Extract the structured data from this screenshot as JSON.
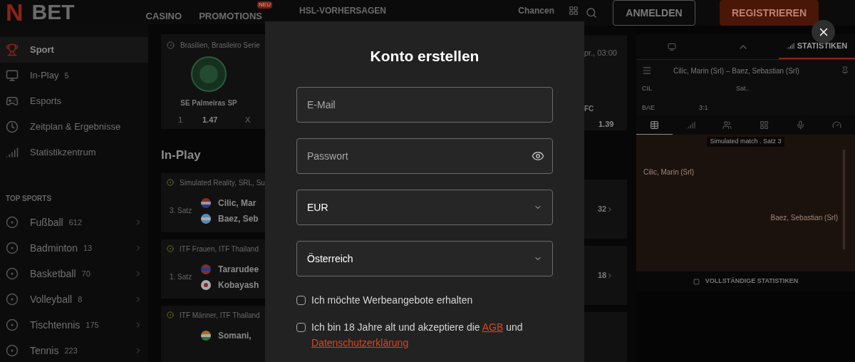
{
  "header": {
    "logo_mark": "N",
    "logo_text": "BET",
    "nav": [
      {
        "label": "CASINO"
      },
      {
        "label": "PROMOTIONS",
        "badge": "NEU"
      }
    ],
    "nav_hidden": [
      {
        "label": "HSL-VORHERSAGEN"
      },
      {
        "label": "Chancen"
      }
    ],
    "login": "ANMELDEN",
    "register": "REGISTRIEREN"
  },
  "sidebar": {
    "items": [
      {
        "kind": "trophy",
        "label": "Sport",
        "selected": true
      },
      {
        "kind": "monitor",
        "label": "In-Play",
        "count": "5",
        "selected": false
      },
      {
        "kind": "gamepad",
        "label": "Esports",
        "selected": false
      },
      {
        "kind": "clock",
        "label": "Zeitplan & Ergebnisse",
        "selected": false
      },
      {
        "kind": "stats",
        "label": "Statistikzentrum",
        "selected": false
      }
    ],
    "section_title": "TOP SPORTS",
    "sports": [
      {
        "label": "Fußball",
        "count": "612"
      },
      {
        "label": "Badminton",
        "count": "13"
      },
      {
        "label": "Basketball",
        "count": "70"
      },
      {
        "label": "Volleyball",
        "count": "8"
      },
      {
        "label": "Tischtennis",
        "count": "175"
      },
      {
        "label": "Tennis",
        "count": "223"
      }
    ]
  },
  "featured": {
    "league": "Brasilien, Brasileiro Serie",
    "team": "SE Palmeiras SP",
    "odd_label_1": "1",
    "odd_value_1": "1.47",
    "odd_label_2": "X",
    "time": "pr., 03:00",
    "team_2": "FC",
    "odd_value_2": "1.39"
  },
  "inplay": {
    "title": "In-Play",
    "events": [
      {
        "league": "Simulated Reality, SRL, Su",
        "period": "3. Satz",
        "players": [
          {
            "name": "Cilic, Mar",
            "kind": "croatia"
          },
          {
            "name": "Baez, Seb",
            "kind": "argentina"
          }
        ],
        "markets": "32"
      },
      {
        "league": "ITF Frauen, ITF Thailand",
        "period": "1. Satz",
        "players": [
          {
            "name": "Tararudee",
            "kind": "thailand"
          },
          {
            "name": "Kobayash",
            "kind": "japan"
          }
        ],
        "markets": "18"
      },
      {
        "league": "ITF Männer, ITF Thailand",
        "players": [
          {
            "name": "Somani, ",
            "kind": "india"
          }
        ]
      }
    ]
  },
  "panel": {
    "tabs": [
      {
        "kind": "live",
        "selected": false
      },
      {
        "kind": "collapse",
        "selected": false
      },
      {
        "kind": "stats",
        "label": "STATISTIKEN",
        "selected": true
      }
    ],
    "match_title": "Cilic, Marin (Srl) – Baez, Sebastian (Srl)",
    "player_1": "CIL",
    "player_2": "BAE",
    "set_label": "Sat..",
    "score": "3:1",
    "stat_tabs": [
      {
        "kind": "table",
        "selected": true
      },
      {
        "kind": "bars",
        "selected": false
      },
      {
        "kind": "users",
        "selected": false
      },
      {
        "kind": "lineup",
        "selected": false
      },
      {
        "kind": "mic",
        "selected": false
      },
      {
        "kind": "gauge",
        "selected": false
      }
    ],
    "field_badge": "Simulated match . Satz 3",
    "field_player_1": "Cilic, Marin (Srl)",
    "field_player_2": "Baez, Sebastian (Srl)",
    "footer": "VOLLSTÄNDIGE STATISTIKEN"
  },
  "modal": {
    "title": "Konto erstellen",
    "fields": [
      {
        "kind": "text",
        "placeholder": "E-Mail"
      },
      {
        "kind": "password",
        "placeholder": "Passwort"
      },
      {
        "kind": "select",
        "value": "EUR"
      },
      {
        "kind": "select",
        "value": "Österreich"
      }
    ],
    "checkboxes": [
      {
        "text": "Ich möchte Werbeangebote erhalten",
        "checked": false
      },
      {
        "text": "Ich bin 18 Jahre alt und akzeptiere die",
        "link_1": "AGB",
        "middle": "und",
        "link_2": "Datenschutzerklärung",
        "checked": false
      }
    ]
  }
}
